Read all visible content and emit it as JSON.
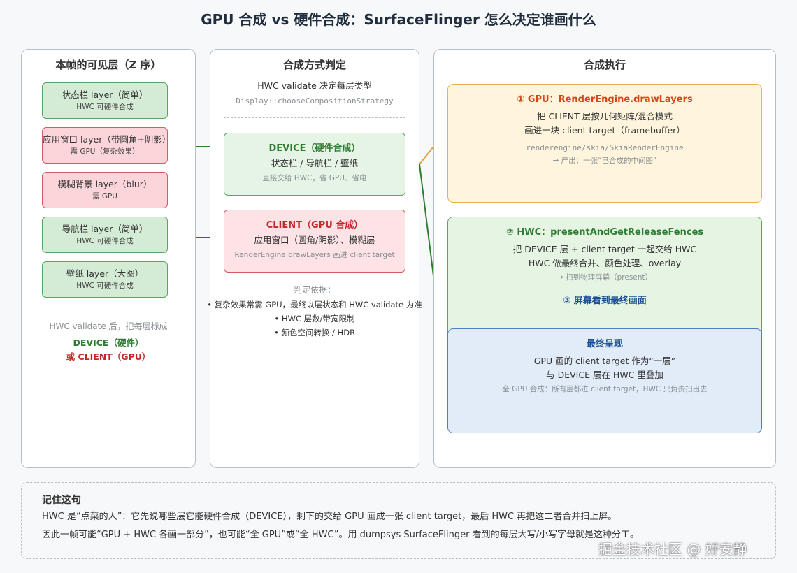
{
  "title": "GPU 合成 vs 硬件合成：SurfaceFlinger 怎么决定谁画什么",
  "left": {
    "title": "本帧的可见层（Z 序）",
    "layers": [
      {
        "name": "状态栏 layer（简单）",
        "note": "HWC 可硬件合成"
      },
      {
        "name": "应用窗口 layer（带圆角+阴影）",
        "note": "需 GPU（复杂效果）"
      },
      {
        "name": "模糊背景 layer（blur）",
        "note": "需 GPU"
      },
      {
        "name": "导航栏 layer（简单）",
        "note": "HWC 可硬件合成"
      },
      {
        "name": "壁纸 layer（大图）",
        "note": "HWC 可硬件合成"
      }
    ],
    "footer": {
      "line1": "HWC validate 后，把每层标成",
      "device": "DEVICE（硬件）",
      "client": "或 CLIENT（GPU）"
    }
  },
  "middle": {
    "title": "合成方式判定",
    "subtitle": "HWC validate 决定每层类型",
    "code": "Display::chooseCompositionStrategy",
    "device": {
      "title": "DEVICE（硬件合成）",
      "line1": "状态栏 / 导航栏 / 壁纸",
      "line2": "直接交给 HWC，省 GPU、省电"
    },
    "client": {
      "title": "CLIENT（GPU 合成）",
      "line1": "应用窗口（圆角/阴影）、模糊层",
      "line2": "RenderEngine.drawLayers 画进 client target"
    },
    "basis": {
      "title": "判定依据：",
      "items": [
        "• 复杂效果常需 GPU，最终以层状态和 HWC validate 为准",
        "• HWC 层数/带宽限制",
        "• 颜色空间转换 / HDR"
      ]
    }
  },
  "right": {
    "title": "合成执行",
    "step1": {
      "title": "① GPU：RenderEngine.drawLayers",
      "line1": "把 CLIENT 层按几何矩阵/混合模式",
      "line2": "画进一块 client target（framebuffer）",
      "code": "renderengine/skia/SkiaRenderEngine",
      "output": "→ 产出：一张“已合成的中间图”"
    },
    "step2": {
      "title": "② HWC：presentAndGetReleaseFences",
      "line1": "把 DEVICE 层 + client target 一起交给 HWC",
      "line2": "HWC 做最终合并、颜色处理、overlay",
      "output": "→ 扫到物理屏幕（present）",
      "step3": "③ 屏幕看到最终画面"
    },
    "final": {
      "title": "最终呈现",
      "line1": "GPU 画的 client target 作为“一层”",
      "line2": "与 DEVICE 层在 HWC 里叠加",
      "line3": "全 GPU 合成：所有层都进 client target，HWC 只负责扫出去"
    }
  },
  "bottom": {
    "title": "记住这句",
    "line1": "HWC 是“点菜的人”：它先说哪些层它能硬件合成（DEVICE），剩下的交给 GPU 画成一张 client target，最后 HWC 再把这二者合并扫上屏。",
    "line2": "因此一帧可能“GPU + HWC 各画一部分”，也可能“全 GPU”或“全 HWC”。用 dumpsys SurfaceFlinger 看到的每层大写/小写字母就是这种分工。"
  },
  "watermark": "掘金技术社区 @ 好安静",
  "colors": {
    "device": "#2e7d32",
    "client": "#c62828",
    "gpu_step": "#d84315",
    "blue_step": "#1a4e96",
    "connector_green": "#2e7d32",
    "connector_red": "#c62828",
    "connector_orange": "#e6a23c"
  }
}
